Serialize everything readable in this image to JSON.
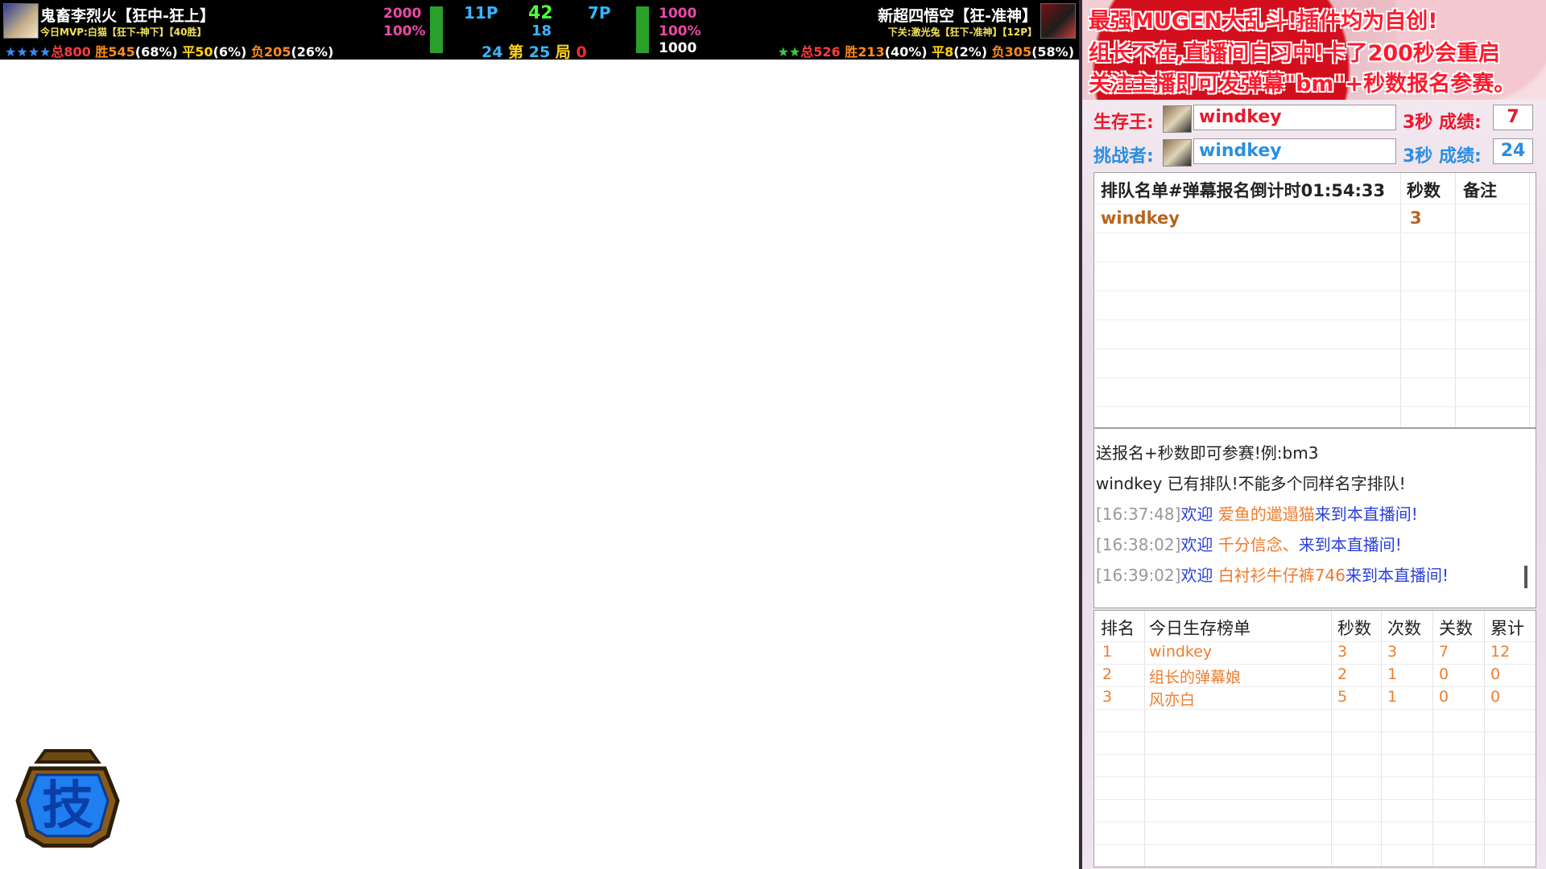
{
  "hud": {
    "p1": {
      "name": "鬼畜李烈火【狂中-狂上】",
      "mvp": "今日MVP:白猫【狂下-神下】【40胜】",
      "stars": "★★★★",
      "total": "总800",
      "wins": "胜545",
      "wins_pct": "(68%)",
      "ties": "平50",
      "ties_pct": "(6%)",
      "losses": "负205",
      "losses_pct": "(26%)",
      "power": "2000",
      "power_pct": "100%"
    },
    "p2": {
      "name": "新超四悟空【狂-准神】",
      "next": "下关:激光兔【狂下-准神】【12P】",
      "stars": "★★",
      "total": "总526",
      "wins": "胜213",
      "wins_pct": "(40%)",
      "ties": "平8",
      "ties_pct": "(2%)",
      "losses": "负305",
      "losses_pct": "(58%)",
      "power": "1000",
      "power_pct": "100%",
      "power2": "1000"
    },
    "center": {
      "p1_level": "11P",
      "timer": "42",
      "p2_level": "7P",
      "sub_timer": "18",
      "left_count": "24",
      "round_prefix": "第",
      "round": "25",
      "round_suffix": "局",
      "right_count": "0"
    }
  },
  "badge": {
    "glyph": "技"
  },
  "panel": {
    "banner": [
      "最强MUGEN大乱斗!插件均为自创!",
      "组长不在,直播间自习中!卡了200秒会重启",
      "关注主播即可发弹幕\"bm\"+秒数报名参赛。"
    ],
    "king": {
      "label": "生存王:",
      "name": "windkey",
      "secs": "3秒 成绩:",
      "score": "7"
    },
    "challenger": {
      "label": "挑战者:",
      "name": "windkey",
      "secs": "3秒 成绩:",
      "score": "24"
    },
    "queue": {
      "headers": [
        "排队名单#弹幕报名倒计时01:54:33",
        "秒数",
        "备注"
      ],
      "rows": [
        {
          "name": "windkey",
          "secs": "3",
          "note": ""
        }
      ]
    },
    "chat": [
      {
        "type": "plain",
        "text": "送报名+秒数即可参赛!例:bm3"
      },
      {
        "type": "plain",
        "text": "windkey 已有排队!不能多个同样名字排队!"
      },
      {
        "type": "welcome",
        "ts": "[16:37:48]",
        "pre": "欢迎 ",
        "user": "爱鱼的邋遢猫",
        "post": "来到本直播间!"
      },
      {
        "type": "welcome",
        "ts": "[16:38:02]",
        "pre": "欢迎 ",
        "user": "千分信念、",
        "post": "来到本直播间!"
      },
      {
        "type": "welcome",
        "ts": "[16:39:02]",
        "pre": "欢迎 ",
        "user": "白衬衫牛仔裤746",
        "post": "来到本直播间!"
      }
    ],
    "ranking": {
      "headers": [
        "排名",
        "今日生存榜单",
        "秒数",
        "次数",
        "关数",
        "累计"
      ],
      "rows": [
        {
          "rank": "1",
          "name": "windkey",
          "secs": "3",
          "times": "3",
          "stages": "7",
          "total": "12"
        },
        {
          "rank": "2",
          "name": "组长的弹幕娘",
          "secs": "2",
          "times": "1",
          "stages": "0",
          "total": "0"
        },
        {
          "rank": "3",
          "name": "风亦白",
          "secs": "5",
          "times": "1",
          "stages": "0",
          "total": "0"
        }
      ]
    }
  }
}
